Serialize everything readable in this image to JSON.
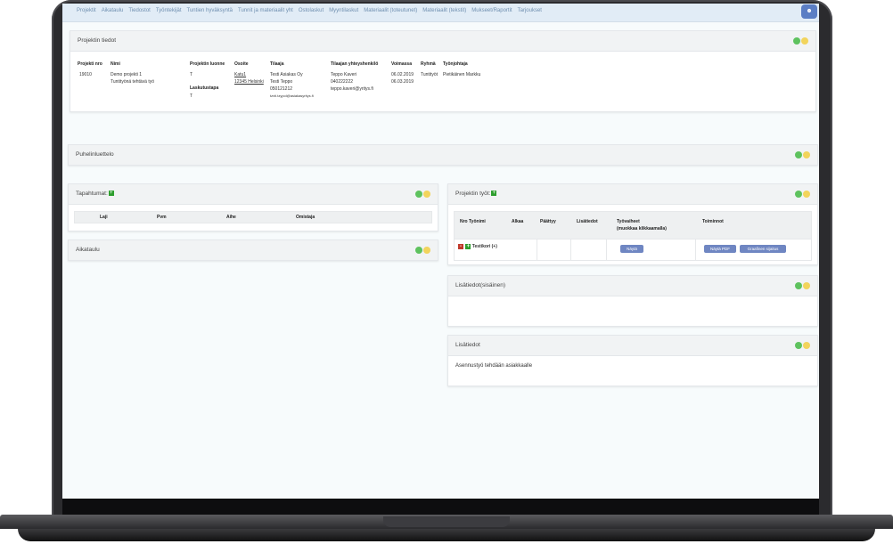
{
  "nav": {
    "items": [
      "Projektit",
      "Aikataulu",
      "Tiedostot",
      "Työntekijät",
      "Tuntien hyväksyntä",
      "Tunnit ja materiaalit yht",
      "Ostolaskut",
      "Myyntilaskut",
      "Materiaalit (toteutunet)",
      "Materiaalit (tekstit)",
      "Mukseet/Raportit",
      "Tarjoukset"
    ],
    "user_icon": "user-icon"
  },
  "project_info": {
    "title": "Projektin tiedot",
    "headers": {
      "nro": "Projekti nro",
      "nimi": "Nimi",
      "luonne": "Projektin luonne",
      "osoite": "Osoite",
      "tilaaja": "Tilaaja",
      "yhteyshenkilo": "Tilaajan yhteyshenkilö",
      "voimassa": "Voimassa",
      "ryhma": "Ryhmä",
      "tyonjohtaja": "Työnjohtaja",
      "laskutustapa": "Laskutustapa"
    },
    "values": {
      "nro": "19010",
      "nimi_1": "Demo projekti 1",
      "nimi_2": "Tuntityönä tehtävä työ",
      "luonne": "T",
      "osoite_1": "Katu1",
      "osoite_2": "12345 Helsinki",
      "tilaaja_1": "Testi Asiakas Oy",
      "tilaaja_2": "Testi Teppo",
      "tilaaja_3": "050121212",
      "tilaaja_4": "tzvti.tzypol@asiakasyritys.fi",
      "yhteyshenkilo_1": "Teppo Kaveri",
      "yhteyshenkilo_2": "040222222",
      "yhteyshenkilo_3": "teppo.kaveri@yritys.fi",
      "voimassa_1": "06.02.2019",
      "voimassa_2": "06.03.2019",
      "ryhma": "Tuntityöt",
      "tyonjohtaja": "Pietikäinen Markku",
      "laskutustapa": "T"
    }
  },
  "phonebook": {
    "title": "Puhelinluettelo"
  },
  "events": {
    "title": "Tapahtumat:",
    "headers": [
      "Laji",
      "Pvm",
      "Aihe",
      "Omistaja"
    ]
  },
  "schedule": {
    "title": "Aikataulu"
  },
  "work_panel": {
    "title": "Projektin työt:",
    "headers": {
      "nro": "Nro Työnimi",
      "alkaa": "Alkaa",
      "paattyy": "Päättyy",
      "lisatiedot": "Lisätiedot",
      "tyovaiheet_1": "Työvaiheet",
      "tyovaiheet_2": "(muokkaa klikkaamalla)",
      "toiminnot": "Toiminnot"
    },
    "row": {
      "name": "Testikori",
      "expand": "(+)",
      "show_button": "Näytä",
      "pdf_button": "Näytä PDF",
      "graph_button": "Graafinen sijaitus"
    }
  },
  "extra_internal": {
    "title": "Lisätiedot(sisäinen)"
  },
  "extra": {
    "title": "Lisätiedot",
    "text": "Asennustyö tehdään asiakkaalle"
  },
  "colors": {
    "nav_bg": "#e1ecf6",
    "nav_text": "#6f8fb0",
    "dot_green": "#5ec25e",
    "dot_yellow": "#f2d45c",
    "button": "#6f86c2",
    "plus": "#2d9e2d"
  }
}
